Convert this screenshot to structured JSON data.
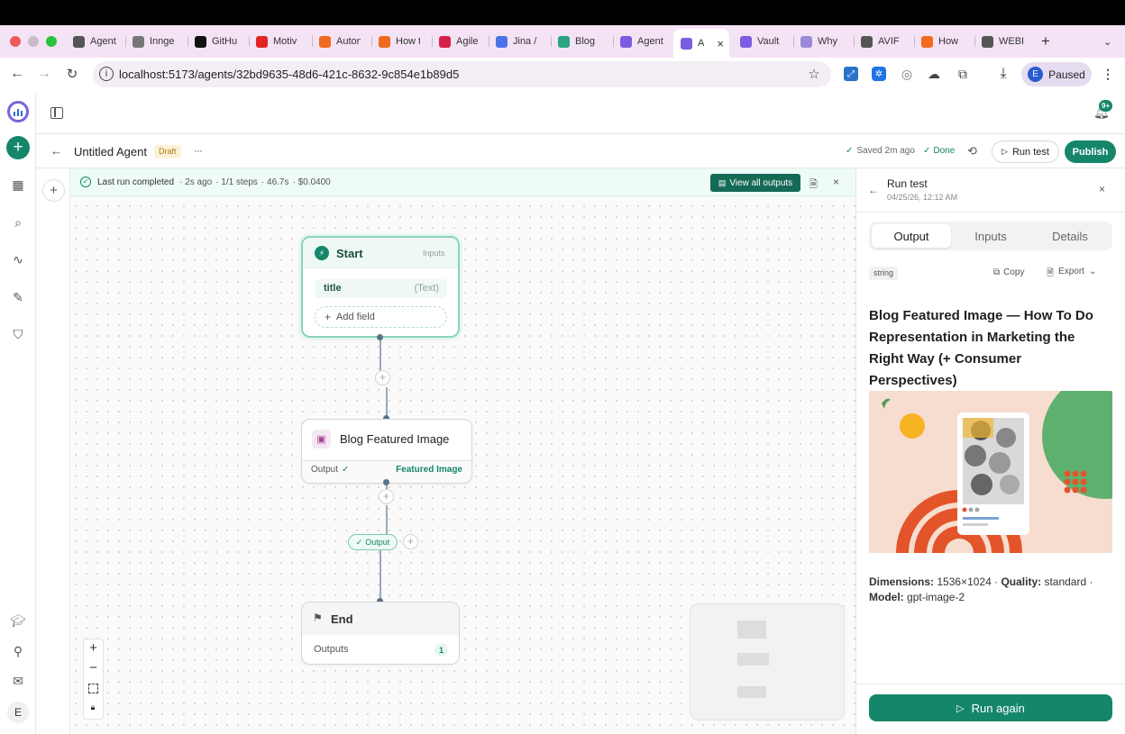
{
  "browser": {
    "tabs": [
      {
        "label": "Agent",
        "icon": "globe-icon",
        "color": "#555"
      },
      {
        "label": "Innge",
        "icon": "inngest-icon",
        "color": "#777"
      },
      {
        "label": "GitHu",
        "icon": "github-icon",
        "color": "#111"
      },
      {
        "label": "Motiv",
        "icon": "youtube-icon",
        "color": "#e02424"
      },
      {
        "label": "Auton",
        "icon": "flame-icon",
        "color": "#f06a1f"
      },
      {
        "label": "How t",
        "icon": "flame-icon",
        "color": "#f06a1f"
      },
      {
        "label": "Agile",
        "icon": "target-icon",
        "color": "#d6204a"
      },
      {
        "label": "Jina /",
        "icon": "jina-icon",
        "color": "#4a73e8"
      },
      {
        "label": "Blog",
        "icon": "blog-icon",
        "color": "#2aa57f"
      },
      {
        "label": "Agent",
        "icon": "agent-icon",
        "color": "#7a5de0"
      },
      {
        "label": "A",
        "icon": "agent-icon",
        "color": "#7a5de0"
      },
      {
        "label": "Vault",
        "icon": "agent-icon",
        "color": "#7a5de0"
      },
      {
        "label": "Why",
        "icon": "why-icon",
        "color": "#9b8ad9"
      },
      {
        "label": "AVIF",
        "icon": "cloud-icon",
        "color": "#555"
      },
      {
        "label": "How",
        "icon": "hubspot-icon",
        "color": "#f36b21"
      },
      {
        "label": "WEBI",
        "icon": "cloud-icon",
        "color": "#555"
      }
    ],
    "url": "localhost:5173/agents/32bd9635-48d6-421c-8632-9c854e1b89d5",
    "profile_initial": "E",
    "profile_status": "Paused"
  },
  "rail": {
    "items": [
      "new-icon",
      "dashboard-icon",
      "search-icon",
      "activity-icon",
      "tools-icon",
      "shield-icon"
    ],
    "bottom": [
      "graduation-icon",
      "plug-icon",
      "mail-icon"
    ],
    "avatar_initial": "E"
  },
  "topbar": {
    "notification_badge": "9+"
  },
  "agent": {
    "title": "Untitled Agent",
    "status": "Draft",
    "more": "···",
    "saved": "Saved 2m ago",
    "done": "Done",
    "run_test": "Run test",
    "publish": "Publish"
  },
  "status": {
    "text": "Last run completed",
    "ago": "· 2s ago",
    "steps": "· 1/1 steps",
    "duration": "· 46.7s",
    "cost": "· $0.0400",
    "view_all": "View all outputs"
  },
  "nodes": {
    "start": {
      "title": "Start",
      "tag": "Inputs",
      "field": "title",
      "field_type": "(Text)",
      "add_field": "Add field"
    },
    "blog": {
      "title": "Blog Featured Image",
      "output_label": "Output",
      "output_value": "Featured Image"
    },
    "output_pill": "Output",
    "end": {
      "title": "End",
      "outputs_label": "Outputs",
      "outputs_count": "1"
    }
  },
  "panel": {
    "title": "Run test",
    "timestamp": "04/25/26, 12:12 AM",
    "tabs": [
      "Output",
      "Inputs",
      "Details"
    ],
    "active_tab": "Output",
    "type_badge": "string",
    "copy": "Copy",
    "export": "Export",
    "heading": "Blog Featured Image — How To Do Representation in Marketing the Right Way (+ Consumer Perspectives)",
    "meta": {
      "dimensions_label": "Dimensions:",
      "dimensions_value": "1536×1024 ·",
      "quality_label": "Quality:",
      "quality_value": "standard ·",
      "model_label": "Model:",
      "model_value": "gpt-image-2"
    },
    "run_again": "Run again"
  },
  "colors": {
    "brand": "#15866a",
    "tab_strip": "#f4e3f4",
    "status_bg": "#eefbf6"
  }
}
